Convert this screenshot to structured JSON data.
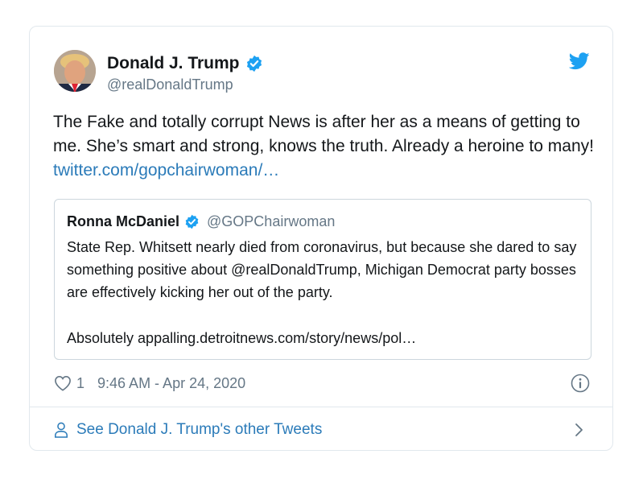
{
  "tweet": {
    "author_name": "Donald J. Trump",
    "author_handle": "@realDonaldTrump",
    "text": "The Fake and totally corrupt News is after her as a means of getting to me. She’s smart and strong, knows the truth. Already a heroine to many! ",
    "link_text": "twitter.com/gopchairwoman/…",
    "like_count": "1",
    "timestamp": "9:46 AM - Apr 24, 2020"
  },
  "quoted_tweet": {
    "author_name": "Ronna McDaniel",
    "author_handle": "@GOPChairwoman",
    "text": "State Rep. Whitsett nearly died from coronavirus, but because she dared to say something positive about @realDonaldTrump, Michigan Democrat party bosses are effectively kicking her out of the party.",
    "text_2": "Absolutely appalling.detroitnews.com/story/news/pol…"
  },
  "footer": {
    "see_more_label": "See Donald J. Trump's other Tweets"
  },
  "icons": {
    "verified": "verified-badge-icon",
    "twitter": "twitter-bird-icon",
    "like": "heart-icon",
    "info": "info-icon",
    "person": "person-icon",
    "chevron": "chevron-right-icon"
  },
  "colors": {
    "verified_blue": "#1da1f2",
    "link_blue": "#2b7bb9",
    "secondary_text": "#657786",
    "border": "#e1e8ed"
  }
}
